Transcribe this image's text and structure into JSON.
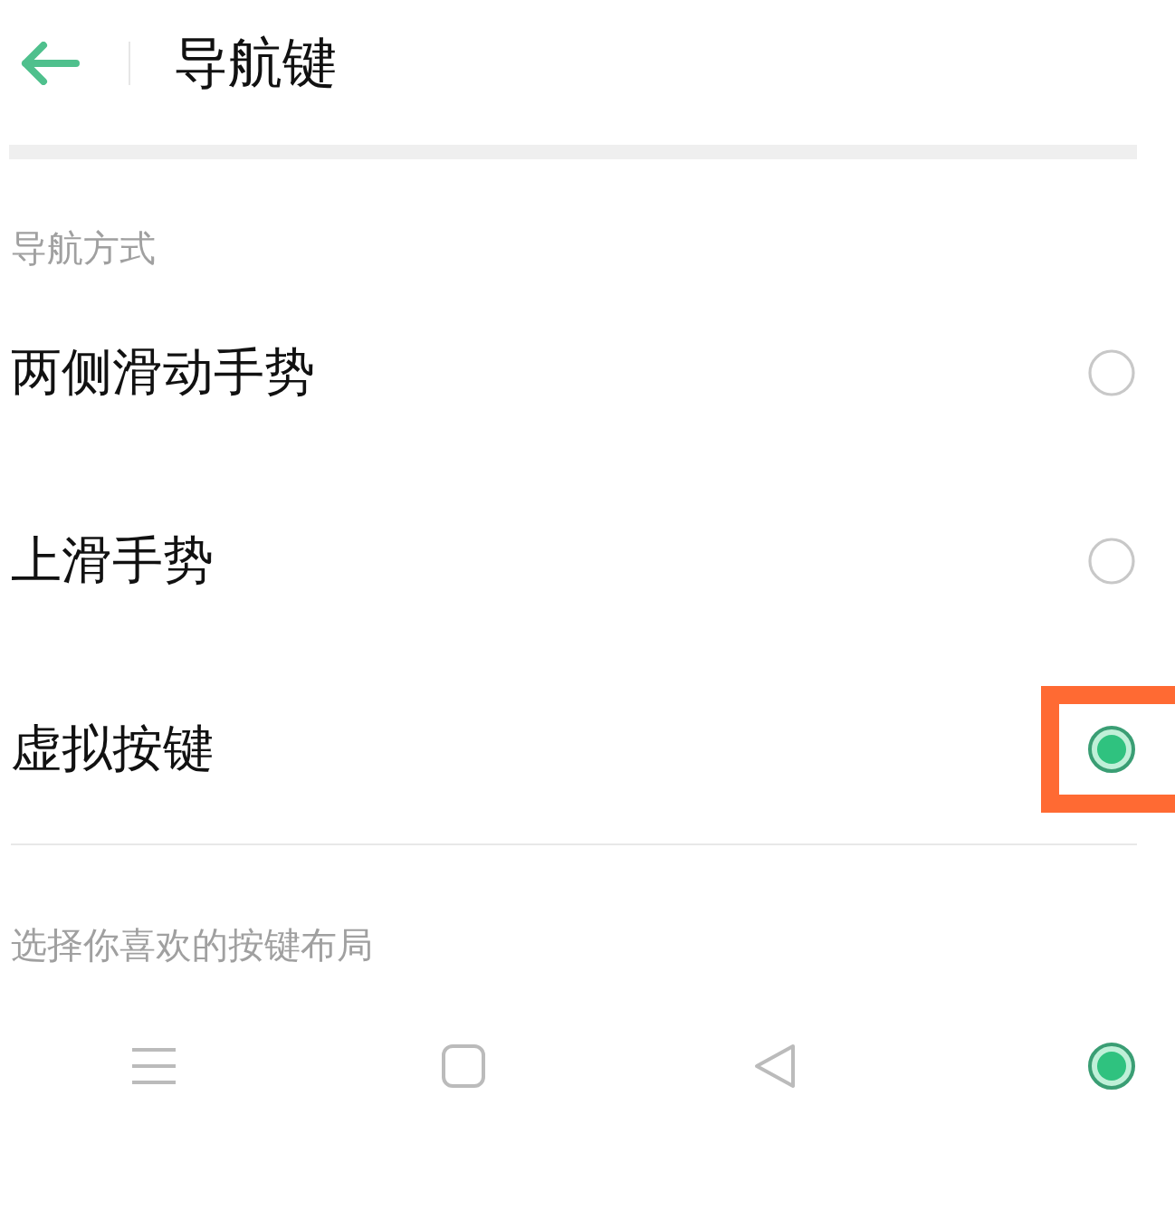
{
  "header": {
    "title": "导航键"
  },
  "navigation_section": {
    "label": "导航方式",
    "options": [
      {
        "label": "两侧滑动手势",
        "selected": false,
        "highlighted": false
      },
      {
        "label": "上滑手势",
        "selected": false,
        "highlighted": false
      },
      {
        "label": "虚拟按键",
        "selected": true,
        "highlighted": true
      }
    ]
  },
  "layout_section": {
    "label": "选择你喜欢的按键布局",
    "layouts": [
      {
        "selected": true
      }
    ]
  }
}
